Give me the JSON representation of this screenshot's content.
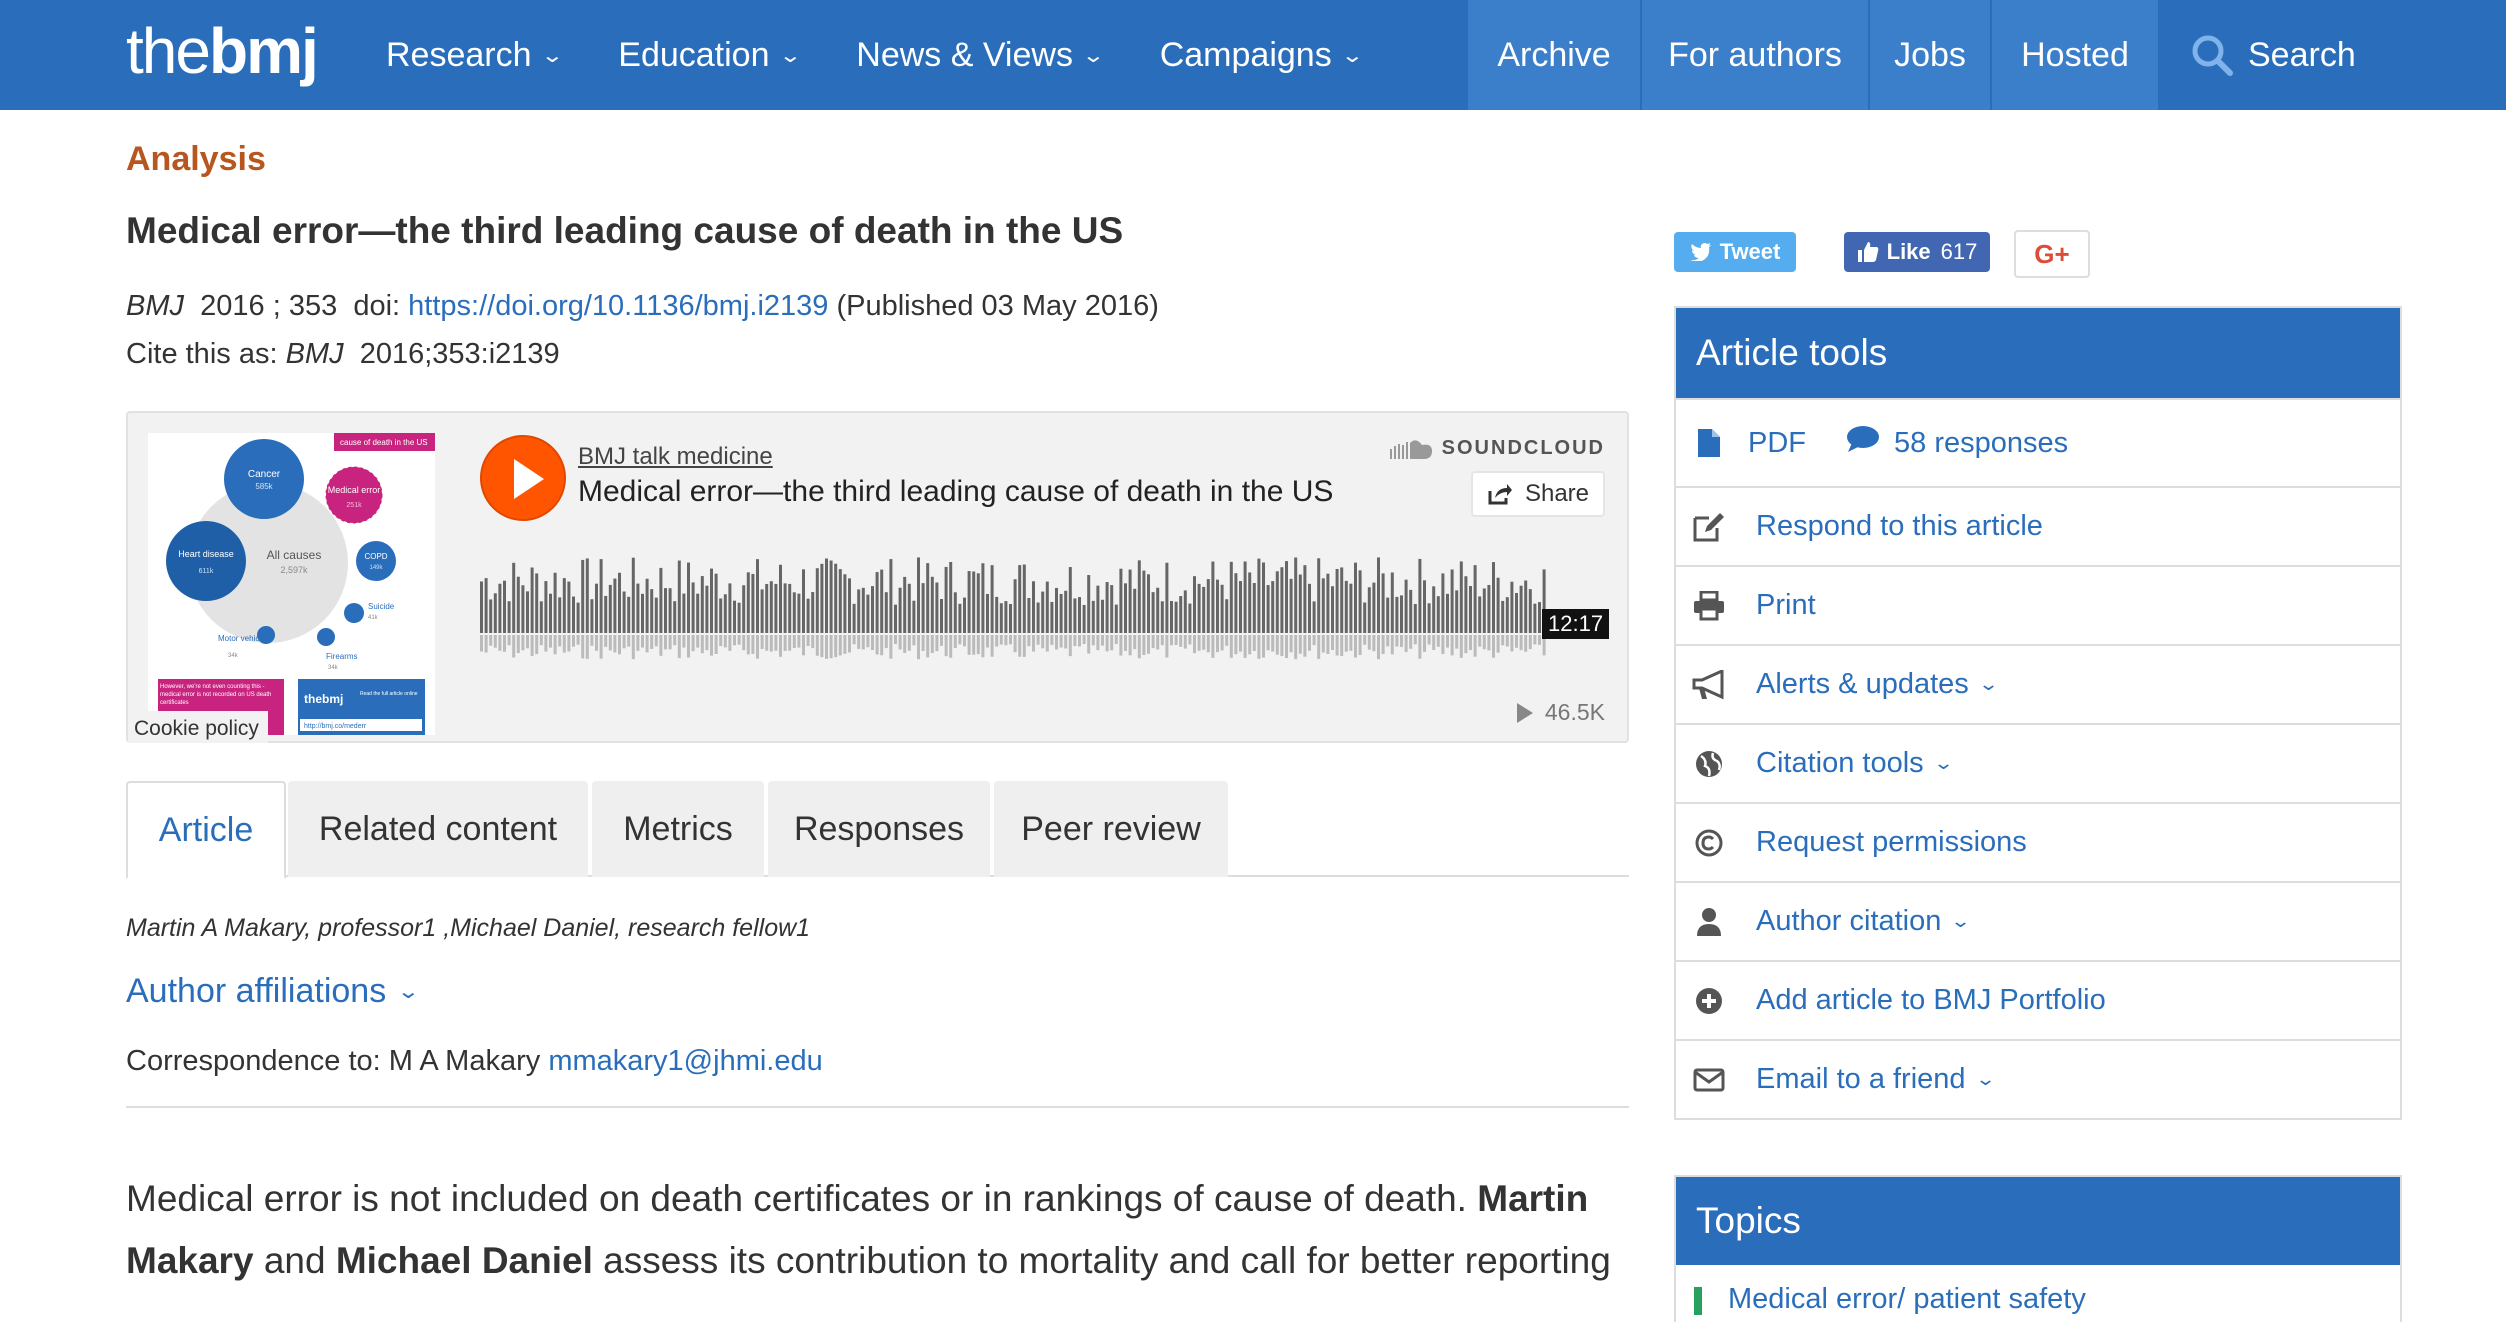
{
  "brand": {
    "logo_light": "the",
    "logo_bold": "bmj"
  },
  "nav": {
    "left": [
      {
        "label": "Research"
      },
      {
        "label": "Education"
      },
      {
        "label": "News & Views"
      },
      {
        "label": "Campaigns"
      }
    ],
    "right": [
      "Archive",
      "For authors",
      "Jobs",
      "Hosted"
    ],
    "search_label": "Search"
  },
  "article": {
    "section": "Analysis",
    "title": "Medical error—the third leading cause of death in the US",
    "journal": "BMJ",
    "year": "2016",
    "volume": "; 353",
    "doi_prefix": "doi:",
    "doi": "https://doi.org/10.1136/bmj.i2139",
    "published": "(Published 03 May 2016)",
    "cite_prefix": "Cite this as:",
    "cite_journal": "BMJ",
    "cite_ref": "2016;353:i2139",
    "authors": "Martin A Makary, professor1 ,Michael Daniel, research fellow1",
    "affiliations_label": "Author affiliations",
    "correspondence_prefix": "Correspondence to: M A Makary",
    "correspondence_email": "mmakary1@jhmi.edu",
    "standfirst_1": "Medical error is not included on death certificates or in rankings of cause of death.",
    "standfirst_author1": "Martin Makary",
    "standfirst_and": "and",
    "standfirst_author2": "Michael Daniel",
    "standfirst_2": "assess its contribution to mortality and call for better reporting"
  },
  "player": {
    "channel": "BMJ talk medicine",
    "track": "Medical error—the third leading cause of death in the US",
    "brand": "SOUNDCLOUD",
    "share_label": "Share",
    "duration": "12:17",
    "plays": "46.5K",
    "cookie_label": "Cookie policy",
    "accent": "#ff5500",
    "art": {
      "banner": "cause of death in the US",
      "cancer": "Cancer",
      "cancer_val": "585k",
      "medical_error": "Medical error",
      "medical_error_val": "251k",
      "heart": "Heart disease",
      "heart_val": "611k",
      "all_causes": "All causes",
      "all_causes_val": "2,597k",
      "copd": "COPD",
      "copd_val": "149k",
      "suicide": "Suicide",
      "suicide_val": "41k",
      "motor": "Motor vehicles",
      "motor_val": "34k",
      "firearms": "Firearms",
      "firearms_val": "34k",
      "footer_note": "However, we're not even counting this - medical error is not recorded on US death certificates",
      "footer_logo": "thebmj",
      "footer_cta": "Read the full article online",
      "footer_url": "http://bmj.co/mederr"
    }
  },
  "tabs": [
    "Article",
    "Related content",
    "Metrics",
    "Responses",
    "Peer review"
  ],
  "active_tab": "Article",
  "social": {
    "tweet": "Tweet",
    "like": "Like",
    "like_count": "617",
    "gplus": "G+"
  },
  "article_tools": {
    "title": "Article tools",
    "pdf": "PDF",
    "responses": "58 responses",
    "items": [
      {
        "label": "Respond to this article",
        "icon": "pencil-icon"
      },
      {
        "label": "Print",
        "icon": "print-icon"
      },
      {
        "label": "Alerts & updates",
        "icon": "megaphone-icon",
        "dropdown": true
      },
      {
        "label": "Citation tools",
        "icon": "globe-icon",
        "dropdown": true
      },
      {
        "label": "Request permissions",
        "icon": "copyright-icon"
      },
      {
        "label": "Author citation",
        "icon": "user-icon",
        "dropdown": true
      },
      {
        "label": "Add article to BMJ Portfolio",
        "icon": "plus-circle-icon"
      },
      {
        "label": "Email to a friend",
        "icon": "envelope-icon",
        "dropdown": true
      }
    ]
  },
  "topics": {
    "title": "Topics",
    "items": [
      "Medical error/ patient safety"
    ]
  },
  "colors": {
    "brand_blue": "#2a6ebb",
    "section_orange": "#b8561f",
    "topic_green": "#27a060"
  }
}
